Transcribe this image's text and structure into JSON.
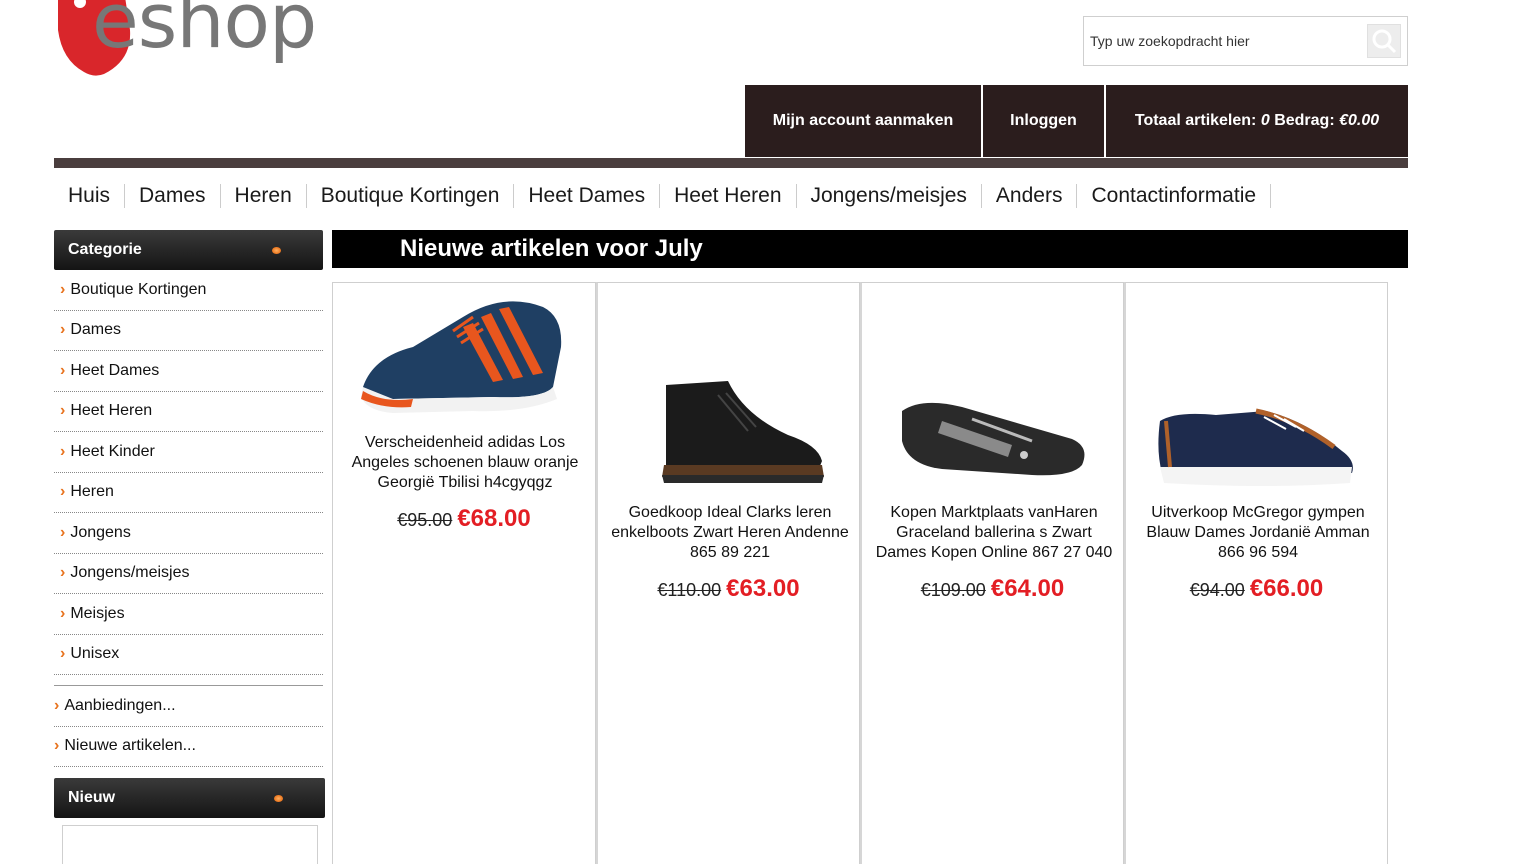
{
  "brand": {
    "logo_text": "eshop"
  },
  "search": {
    "placeholder": "Typ uw zoekopdracht hier"
  },
  "account": {
    "create_label": "Mijn account aanmaken",
    "login_label": "Inloggen",
    "total_prefix": "Totaal artikelen:",
    "total_count": "0",
    "amount_label": "Bedrag:",
    "amount_value": "€0.00"
  },
  "topnav": [
    "Huis",
    "Dames",
    "Heren",
    "Boutique Kortingen",
    "Heet Dames",
    "Heet Heren",
    "Jongens/meisjes",
    "Anders",
    "Contactinformatie"
  ],
  "sidebar": {
    "category_title": "Categorie",
    "categories": [
      "Boutique Kortingen",
      "Dames",
      "Heet Dames",
      "Heet Heren",
      "Heet Kinder",
      "Heren",
      "Jongens",
      "Jongens/meisjes",
      "Meisjes",
      "Unisex"
    ],
    "extras": [
      "Aanbiedingen...",
      "Nieuwe artikelen..."
    ],
    "new_title": "Nieuw"
  },
  "main": {
    "title": "Nieuwe artikelen voor July",
    "products": [
      {
        "name": "Verscheidenheid adidas Los Angeles schoenen blauw oranje Georgië Tbilisi h4cgyqgz",
        "old_price": "€95.00",
        "new_price": "€68.00"
      },
      {
        "name": "Goedkoop Ideal Clarks leren enkelboots Zwart Heren Andenne 865 89 221",
        "old_price": "€110.00",
        "new_price": "€63.00"
      },
      {
        "name": "Kopen Marktplaats vanHaren Graceland ballerina s Zwart Dames Kopen Online 867 27 040",
        "old_price": "€109.00",
        "new_price": "€64.00"
      },
      {
        "name": "Uitverkoop McGregor gympen Blauw Dames Jordanië Amman 866 96 594",
        "old_price": "€94.00",
        "new_price": "€66.00"
      }
    ]
  },
  "colors": {
    "accent": "#e31e24",
    "dark_bar": "#2b1d1d",
    "chevron": "#e8731e"
  }
}
